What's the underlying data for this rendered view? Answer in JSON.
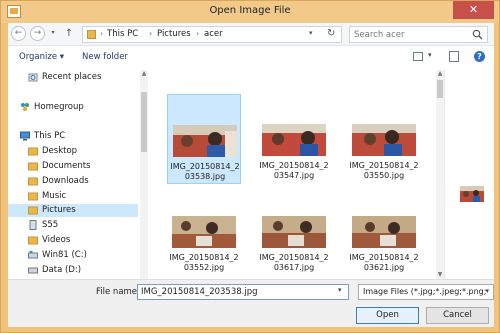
{
  "window": {
    "title": "Open Image File",
    "close_glyph": "✕"
  },
  "nav": {
    "back_glyph": "←",
    "forward_glyph": "→",
    "recent_glyph": "▾",
    "up_glyph": "↑",
    "breadcrumbs": [
      "This PC",
      "Pictures",
      "acer"
    ],
    "separator": "›",
    "address_dropdown_glyph": "▾",
    "refresh_glyph": "↻",
    "search_placeholder": "Search acer"
  },
  "toolbar": {
    "organize_label": "Organize ▾",
    "new_folder_label": "New folder",
    "view_dropdown_glyph": "▾",
    "help_glyph": "?"
  },
  "sidebar": {
    "items": [
      {
        "label": "Recent places",
        "icon": "recent-places-icon"
      },
      {
        "label": "Homegroup",
        "icon": "homegroup-icon"
      },
      {
        "label": "This PC",
        "icon": "computer-icon"
      },
      {
        "label": "Desktop",
        "icon": "folder-icon"
      },
      {
        "label": "Documents",
        "icon": "folder-icon"
      },
      {
        "label": "Downloads",
        "icon": "folder-icon"
      },
      {
        "label": "Music",
        "icon": "folder-icon"
      },
      {
        "label": "Pictures",
        "icon": "folder-icon"
      },
      {
        "label": "S55",
        "icon": "device-icon"
      },
      {
        "label": "Videos",
        "icon": "folder-icon"
      },
      {
        "label": "Win81 (C:)",
        "icon": "drive-icon"
      },
      {
        "label": "Data (D:)",
        "icon": "drive-icon"
      }
    ],
    "selected": "Pictures"
  },
  "files": [
    {
      "name": "IMG_20150814_203538.jpg",
      "selected": true
    },
    {
      "name": "IMG_20150814_203547.jpg",
      "selected": false
    },
    {
      "name": "IMG_20150814_203550.jpg",
      "selected": false
    },
    {
      "name": "IMG_20150814_203552.jpg",
      "selected": false
    },
    {
      "name": "IMG_20150814_203617.jpg",
      "selected": false
    },
    {
      "name": "IMG_20150814_203621.jpg",
      "selected": false
    }
  ],
  "bottom": {
    "file_name_label": "File name:",
    "file_name_value": "IMG_20150814_203538.jpg",
    "file_name_dropdown_glyph": "▾",
    "file_type_value": "Image Files (*.jpg;*.jpeg;*.png;",
    "file_type_dropdown_glyph": "▾",
    "open_label": "Open",
    "cancel_label": "Cancel"
  },
  "scrollbar": {
    "up_glyph": "▲",
    "down_glyph": "▼"
  },
  "colors": {
    "titlebar": "#f3c98a",
    "close": "#c7504b",
    "selection": "#cce8ff",
    "accent": "#2f6fc1"
  }
}
